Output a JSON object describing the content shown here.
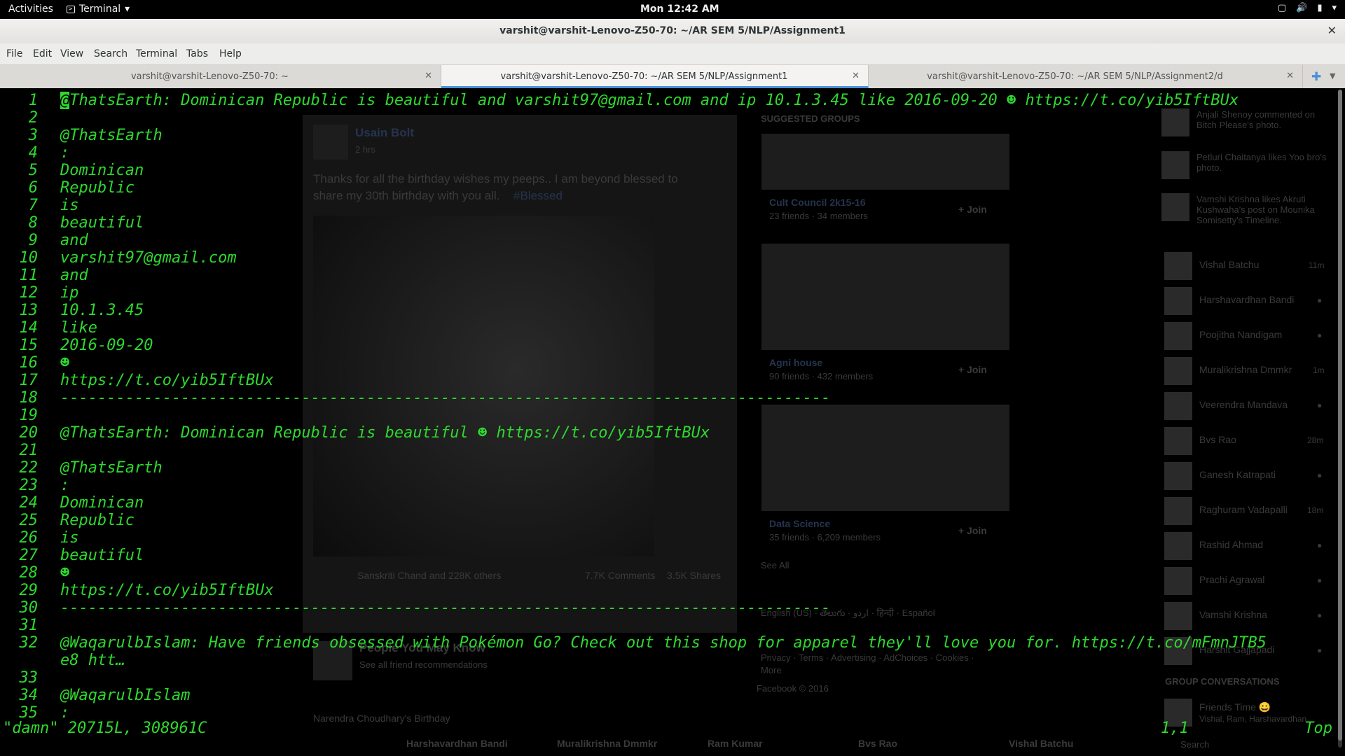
{
  "topbar": {
    "activities": "Activities",
    "app_name": "Terminal",
    "clock": "Mon 12:42 AM"
  },
  "window": {
    "title": "varshit@varshit-Lenovo-Z50-70: ~/AR SEM 5/NLP/Assignment1"
  },
  "menu": [
    "File",
    "Edit",
    "View",
    "Search",
    "Terminal",
    "Tabs",
    "Help"
  ],
  "tabs": [
    {
      "label": "varshit@varshit-Lenovo-Z50-70: ~"
    },
    {
      "label": "varshit@varshit-Lenovo-Z50-70: ~/AR SEM 5/NLP/Assignment1"
    },
    {
      "label": "varshit@varshit-Lenovo-Z50-70: ~/AR SEM 5/NLP/Assignment2/d"
    }
  ],
  "editor": {
    "lines": [
      "@ThatsEarth: Dominican Republic is beautiful and varshit97@gmail.com and ip 10.1.3.45 like 2016-09-20 ☻ https://t.co/yib5IftBUx",
      "",
      "@ThatsEarth",
      ":",
      "Dominican",
      "Republic",
      "is",
      "beautiful",
      "and",
      "varshit97@gmail.com",
      "and",
      "ip",
      "10.1.3.45",
      "like",
      "2016-09-20",
      "☻",
      "https://t.co/yib5IftBUx",
      "-----------------------------------------------------------------------------------",
      "",
      "@ThatsEarth: Dominican Republic is beautiful ☻ https://t.co/yib5IftBUx",
      "",
      "@ThatsEarth",
      ":",
      "Dominican",
      "Republic",
      "is",
      "beautiful",
      "☻",
      "https://t.co/yib5IftBUx",
      "-----------------------------------------------------------------------------------",
      "",
      "@WaqarulbIslam: Have friends obsessed with Pokémon Go? Check out this shop for apparel they'll love you for. https://t.co/mFmnJTB5",
      "e8 htt…",
      "",
      "@WaqarulbIslam",
      ":"
    ],
    "line_numbers": [
      "1",
      "2",
      "3",
      "4",
      "5",
      "6",
      "7",
      "8",
      "9",
      "10",
      "11",
      "12",
      "13",
      "14",
      "15",
      "16",
      "17",
      "18",
      "19",
      "20",
      "21",
      "22",
      "23",
      "24",
      "25",
      "26",
      "27",
      "28",
      "29",
      "30",
      "31",
      "32",
      "",
      "33",
      "34",
      "35"
    ],
    "status_file": "\"damn\" 20715L, 308961C",
    "status_pos": "1,1",
    "status_scroll": "Top"
  },
  "background": {
    "post_author": "Usain Bolt",
    "post_time": "2 hrs",
    "post_text_1": "Thanks for all the birthday wishes my peeps.. I am beyond blessed to",
    "post_text_2": "share my 30th birthday with you all.",
    "post_hashtag": "#Blessed",
    "reactions": "Sanskriti Chand and 228K others",
    "comments": "7.7K Comments",
    "shares": "3.5K Shares",
    "suggested_groups": "SUGGESTED GROUPS",
    "groups": [
      {
        "name": "Cult Council 2k15-16",
        "meta": "23 friends · 34 members",
        "join": "+ Join"
      },
      {
        "name": "Agni house",
        "meta": "90 friends · 432 members",
        "join": "+ Join"
      },
      {
        "name": "Data Science",
        "meta": "35 friends · 6,209 members",
        "join": "+ Join"
      }
    ],
    "see_all": "See All",
    "languages": "English (US) · తెలుగు · اردو · हिन्दी · Español",
    "footer_links": "Privacy · Terms · Advertising · AdChoices · Cookies ·",
    "footer_more": "More",
    "copyright": "Facebook © 2016",
    "pymk": "People You May Know",
    "pymk_sub": "See all friend recommendations",
    "birthday": "Narendra Choudhary's Birthday",
    "bottom_names": [
      "Harshavardhan Bandi",
      "Muralikrishna Dmmkr",
      "Ram Kumar",
      "Bvs Rao",
      "Vishal Batchu"
    ],
    "ticker": [
      "Anjali Shenoy commented on Bitch Please's photo.",
      "Petluri Chaitanya likes Yoo bro's photo.",
      "Vamshi Krishna likes Akruti Kushwaha's post on Mounika Somisetty's Timeline."
    ],
    "chat": [
      {
        "name": "Vishal Batchu",
        "status": "11m"
      },
      {
        "name": "Harshavardhan Bandi",
        "status": "●"
      },
      {
        "name": "Poojitha Nandigam",
        "status": "●"
      },
      {
        "name": "Muralikrishna Dmmkr",
        "status": "1m"
      },
      {
        "name": "Veerendra Mandava",
        "status": "●"
      },
      {
        "name": "Bvs Rao",
        "status": "28m"
      },
      {
        "name": "Ganesh Katrapati",
        "status": "●"
      },
      {
        "name": "Raghuram Vadapalli",
        "status": "18m"
      },
      {
        "name": "Rashid Ahmad",
        "status": "●"
      },
      {
        "name": "Prachi Agrawal",
        "status": "●"
      },
      {
        "name": "Vamshi Krishna",
        "status": "●"
      },
      {
        "name": "Harshit Gajjapadi",
        "status": "●"
      }
    ],
    "group_conversations": "GROUP CONVERSATIONS",
    "friends_time": "Friends Time 😀",
    "friends_time_sub": "Vishal, Ram, Harshavardhan",
    "search": "Search"
  },
  "colors": {
    "terminal_text": "#2ed82e",
    "terminal_bg": "#000000",
    "tab_accent": "#4a90d9"
  }
}
